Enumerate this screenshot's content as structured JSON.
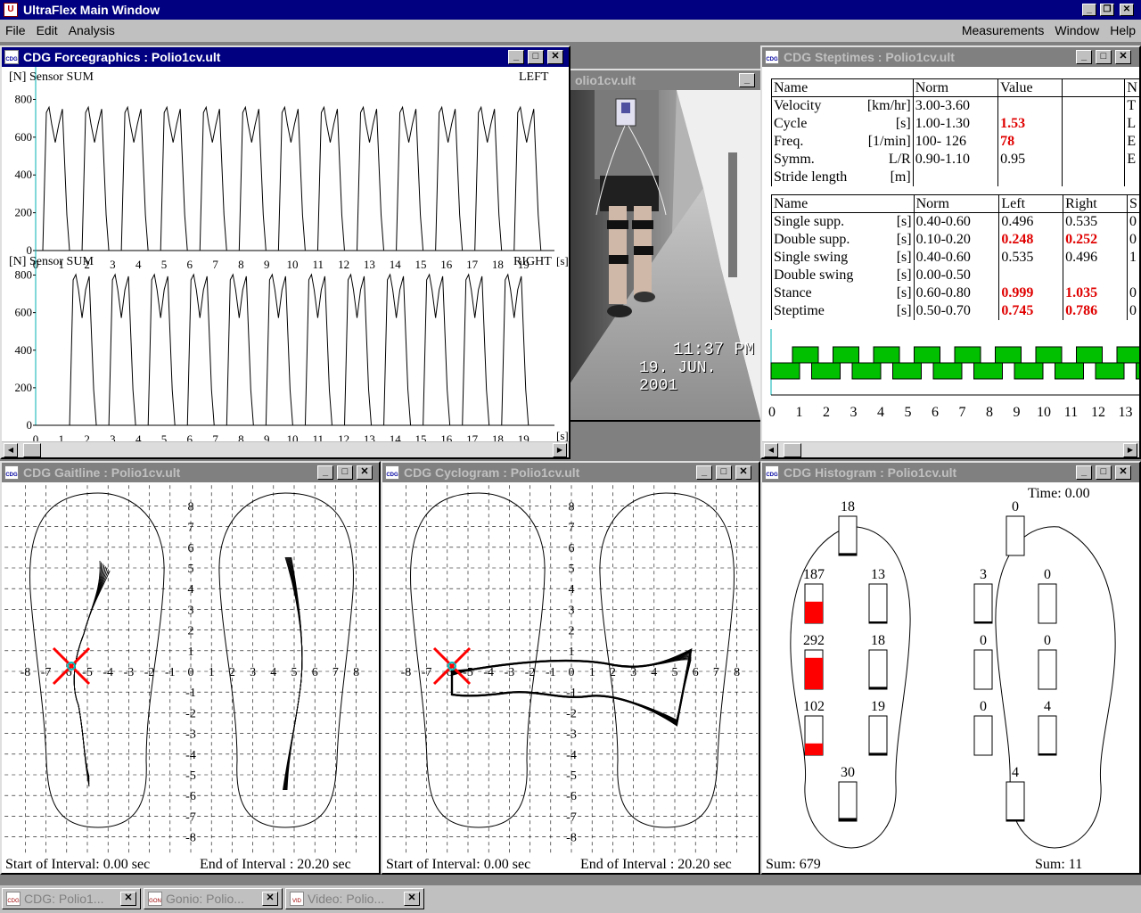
{
  "app": {
    "title": "UltraFlex Main Window",
    "icon": "app-icon"
  },
  "menu": {
    "file": "File",
    "edit": "Edit",
    "analysis": "Analysis",
    "measurements": "Measurements",
    "window": "Window",
    "help": "Help"
  },
  "windows": {
    "force": {
      "title": "CDG Forcegraphics : Polio1cv.ult",
      "top": {
        "unit": "[N]",
        "sensor": "Sensor SUM",
        "side": "LEFT"
      },
      "bottom": {
        "unit": "[N]",
        "sensor": "Sensor SUM",
        "side": "RIGHT"
      },
      "xunit": "[s]"
    },
    "video": {
      "title": "olio1cv.ult",
      "time": "11:37 PM",
      "date": "19. JUN. 2001"
    },
    "steptimes": {
      "title": "CDG Steptimes : Polio1cv.ult"
    },
    "gaitline": {
      "title": "CDG Gaitline : Polio1cv.ult",
      "start": "Start of Interval:  0.00 sec",
      "end": "End of Interval   : 20.20 sec"
    },
    "cyclogram": {
      "title": "CDG Cyclogram : Polio1cv.ult",
      "start": "Start of Interval:  0.00 sec",
      "end": "End of Interval   : 20.20 sec"
    },
    "histogram": {
      "title": "CDG Histogram : Polio1cv.ult",
      "time": "Time: 0.00",
      "sum_left": "Sum:  679",
      "sum_right": "Sum:    11"
    }
  },
  "table1": {
    "header": [
      "Name",
      "Norm",
      "Value",
      "",
      "N"
    ],
    "rows": [
      {
        "name": "Velocity",
        "unit": "[km/hr]",
        "norm": "3.00-3.60",
        "value": "",
        "value_red": false,
        "extra": "",
        "last": "T"
      },
      {
        "name": "Cycle",
        "unit": "[s]",
        "norm": "1.00-1.30",
        "value": "1.53",
        "value_red": true,
        "extra": "",
        "last": "L"
      },
      {
        "name": "Freq.",
        "unit": "[1/min]",
        "norm": " 100- 126",
        "value": "78",
        "value_red": true,
        "extra": "",
        "last": "E"
      },
      {
        "name": "Symm.",
        "unit": "L/R",
        "norm": "0.90-1.10",
        "value": "0.95",
        "value_red": false,
        "extra": "",
        "last": "E"
      },
      {
        "name": "Stride length",
        "unit": "[m]",
        "norm": "",
        "value": "",
        "value_red": false,
        "extra": "",
        "last": ""
      }
    ]
  },
  "table2": {
    "header": [
      "Name",
      "Norm",
      "Left",
      "Right",
      "S"
    ],
    "rows": [
      {
        "name": "Single supp.",
        "unit": "[s]",
        "norm": "0.40-0.60",
        "left": "0.496",
        "left_red": false,
        "right": "0.535",
        "right_red": false,
        "last": "0"
      },
      {
        "name": "Double supp.",
        "unit": "[s]",
        "norm": "0.10-0.20",
        "left": "0.248",
        "left_red": true,
        "right": "0.252",
        "right_red": true,
        "last": "0"
      },
      {
        "name": "Single swing",
        "unit": "[s]",
        "norm": "0.40-0.60",
        "left": "0.535",
        "left_red": false,
        "right": "0.496",
        "right_red": false,
        "last": "1"
      },
      {
        "name": "Double swing",
        "unit": "[s]",
        "norm": "0.00-0.50",
        "left": "",
        "left_red": false,
        "right": "",
        "right_red": false,
        "last": ""
      },
      {
        "name": "Stance",
        "unit": "[s]",
        "norm": "0.60-0.80",
        "left": "0.999",
        "left_red": true,
        "right": "1.035",
        "right_red": true,
        "last": "0"
      },
      {
        "name": "Steptime",
        "unit": "[s]",
        "norm": "0.50-0.70",
        "left": "0.745",
        "left_red": true,
        "right": "0.786",
        "right_red": true,
        "last": "0"
      }
    ]
  },
  "steps_axis": [
    "0",
    "1",
    "2",
    "3",
    "4",
    "5",
    "6",
    "7",
    "8",
    "9",
    "10",
    "11",
    "12",
    "13"
  ],
  "force_xticks": [
    "0",
    "1",
    "2",
    "3",
    "4",
    "5",
    "6",
    "7",
    "8",
    "9",
    "10",
    "11",
    "12",
    "13",
    "14",
    "15",
    "16",
    "17",
    "18",
    "19"
  ],
  "force_yticks": [
    "0",
    "200",
    "400",
    "600",
    "800"
  ],
  "grid_xticks": [
    "-8",
    "-7",
    "-6",
    "-5",
    "-4",
    "-3",
    "-2",
    "-1",
    "0",
    "1",
    "2",
    "3",
    "4",
    "5",
    "6",
    "7",
    "8"
  ],
  "grid_yticks": [
    "8",
    "7",
    "6",
    "5",
    "4",
    "3",
    "2",
    "1",
    "0",
    "-1",
    "-2",
    "-3",
    "-4",
    "-5",
    "-6",
    "-7",
    "-8"
  ],
  "histogram": {
    "left": [
      {
        "value": "18",
        "fill": 0.06
      },
      {
        "value": "187",
        "fill": 0.55
      },
      {
        "value": "13",
        "fill": 0.04
      },
      {
        "value": "292",
        "fill": 0.8
      },
      {
        "value": "18",
        "fill": 0.06
      },
      {
        "value": "102",
        "fill": 0.3
      },
      {
        "value": "19",
        "fill": 0.06
      },
      {
        "value": "30",
        "fill": 0.08
      }
    ],
    "right": [
      {
        "value": "0",
        "fill": 0
      },
      {
        "value": "3",
        "fill": 0.01
      },
      {
        "value": "0",
        "fill": 0
      },
      {
        "value": "0",
        "fill": 0
      },
      {
        "value": "0",
        "fill": 0
      },
      {
        "value": "0",
        "fill": 0
      },
      {
        "value": "4",
        "fill": 0.02
      },
      {
        "value": "4",
        "fill": 0.02
      }
    ]
  },
  "taskbar": [
    {
      "label": "CDG: Polio1...",
      "icon": "cdg-icon"
    },
    {
      "label": "Gonio: Polio...",
      "icon": "gonio-icon"
    },
    {
      "label": "Video: Polio...",
      "icon": "video-icon"
    }
  ],
  "colors": {
    "title_active": "#000080",
    "title_inactive": "#808080",
    "highlight_red": "#e00000",
    "step_green": "#00c000",
    "marker_red": "#ff0000",
    "marker_cyan": "#00c0c0"
  }
}
